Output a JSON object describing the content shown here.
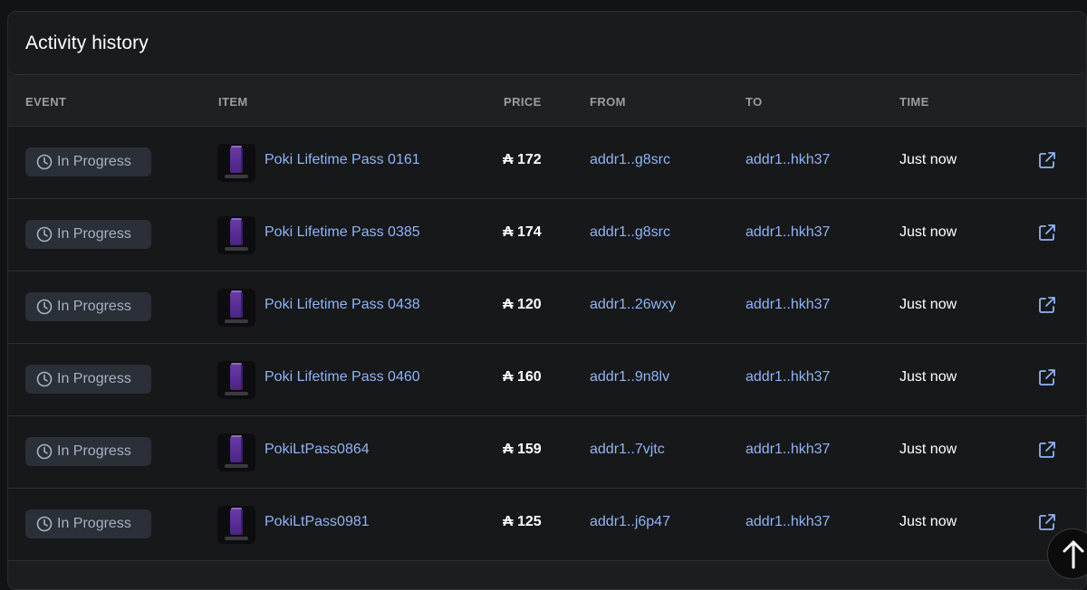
{
  "panel": {
    "title": "Activity history"
  },
  "columns": {
    "event": "EVENT",
    "item": "ITEM",
    "price": "PRICE",
    "from": "FROM",
    "to": "TO",
    "time": "TIME"
  },
  "colors": {
    "link": "#8fb4f5",
    "badge_bg": "#2a2f38",
    "badge_text": "#a8b2c2",
    "nft_purple": "#6a3aa6"
  },
  "rows": [
    {
      "event": "In Progress",
      "item": "Poki Lifetime Pass 0161",
      "price": "₳ 172",
      "from": "addr1..g8src",
      "to": "addr1..hkh37",
      "time": "Just now"
    },
    {
      "event": "In Progress",
      "item": "Poki Lifetime Pass 0385",
      "price": "₳ 174",
      "from": "addr1..g8src",
      "to": "addr1..hkh37",
      "time": "Just now"
    },
    {
      "event": "In Progress",
      "item": "Poki Lifetime Pass 0438",
      "price": "₳ 120",
      "from": "addr1..26wxy",
      "to": "addr1..hkh37",
      "time": "Just now"
    },
    {
      "event": "In Progress",
      "item": "Poki Lifetime Pass 0460",
      "price": "₳ 160",
      "from": "addr1..9n8lv",
      "to": "addr1..hkh37",
      "time": "Just now"
    },
    {
      "event": "In Progress",
      "item": "PokiLtPass0864",
      "price": "₳ 159",
      "from": "addr1..7vjtc",
      "to": "addr1..hkh37",
      "time": "Just now"
    },
    {
      "event": "In Progress",
      "item": "PokiLtPass0981",
      "price": "₳ 125",
      "from": "addr1..j6p47",
      "to": "addr1..hkh37",
      "time": "Just now"
    }
  ],
  "icons": {
    "event": "clock-icon",
    "action": "external-link-icon",
    "scroll": "arrow-up-icon"
  }
}
